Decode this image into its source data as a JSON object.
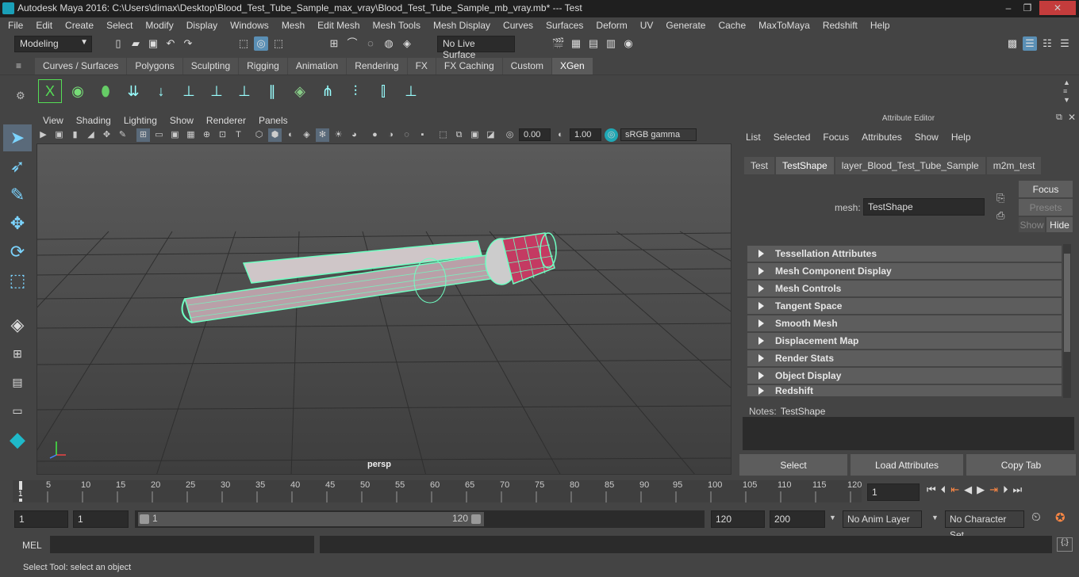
{
  "window": {
    "title": "Autodesk Maya 2016: C:\\Users\\dimax\\Desktop\\Blood_Test_Tube_Sample_max_vray\\Blood_Test_Tube_Sample_mb_vray.mb*   ---   Test",
    "minimize": "–",
    "restore": "❐",
    "close": "✕"
  },
  "menubar": [
    "File",
    "Edit",
    "Create",
    "Select",
    "Modify",
    "Display",
    "Windows",
    "Mesh",
    "Edit Mesh",
    "Mesh Tools",
    "Mesh Display",
    "Curves",
    "Surfaces",
    "Deform",
    "UV",
    "Generate",
    "Cache",
    "MaxToMaya",
    "Redshift",
    "Help"
  ],
  "status_line": {
    "mode": "Modeling",
    "live_surface": "No Live Surface"
  },
  "shelf": {
    "tabs": [
      "Curves / Surfaces",
      "Polygons",
      "Sculpting",
      "Rigging",
      "Animation",
      "Rendering",
      "FX",
      "FX Caching",
      "Custom",
      "XGen"
    ],
    "active_tab": "XGen",
    "icons": [
      "xgen-x-icon",
      "eye-icon",
      "leaf-icon",
      "guides-icon",
      "arrow-down-icon",
      "add-guide-icon",
      "view-guide-icon",
      "lock-guide-icon",
      "strands-icon",
      "layers-icon",
      "sculpt-icon",
      "groom-icon",
      "cut-icon",
      "comb-icon"
    ]
  },
  "viewport": {
    "menu": [
      "View",
      "Shading",
      "Lighting",
      "Show",
      "Renderer",
      "Panels"
    ],
    "exposure": "0.00",
    "gamma": "1.00",
    "color_space": "sRGB gamma",
    "camera": "persp"
  },
  "attribute_editor": {
    "title": "Attribute Editor",
    "menu": [
      "List",
      "Selected",
      "Focus",
      "Attributes",
      "Show",
      "Help"
    ],
    "tabs": [
      "Test",
      "TestShape",
      "layer_Blood_Test_Tube_Sample",
      "m2m_test"
    ],
    "active_tab": "TestShape",
    "mesh_label": "mesh:",
    "mesh_value": "TestShape",
    "focus_btn": "Focus",
    "presets_btn": "Presets",
    "show_btn": "Show",
    "hide_btn": "Hide",
    "sections": [
      "Tessellation Attributes",
      "Mesh Component Display",
      "Mesh Controls",
      "Tangent Space",
      "Smooth Mesh",
      "Displacement Map",
      "Render Stats",
      "Object Display",
      "Redshift"
    ],
    "notes_label": "Notes:",
    "notes_value": "TestShape",
    "bottom_buttons": [
      "Select",
      "Load Attributes",
      "Copy Tab"
    ]
  },
  "timeline": {
    "ticks": [
      "5",
      "10",
      "15",
      "20",
      "25",
      "30",
      "35",
      "40",
      "45",
      "50",
      "55",
      "60",
      "65",
      "70",
      "75",
      "80",
      "85",
      "90",
      "95",
      "100",
      "105",
      "110",
      "115",
      "120"
    ],
    "current_frame": "1",
    "playhead_label": "1"
  },
  "range": {
    "start": "1",
    "playback_start": "1",
    "slider_start": "1",
    "slider_end": "120",
    "playback_end": "120",
    "end": "200",
    "anim_layer": "No Anim Layer",
    "character_set": "No Character Set"
  },
  "command": {
    "label": "MEL"
  },
  "help_line": "Select Tool: select an object"
}
